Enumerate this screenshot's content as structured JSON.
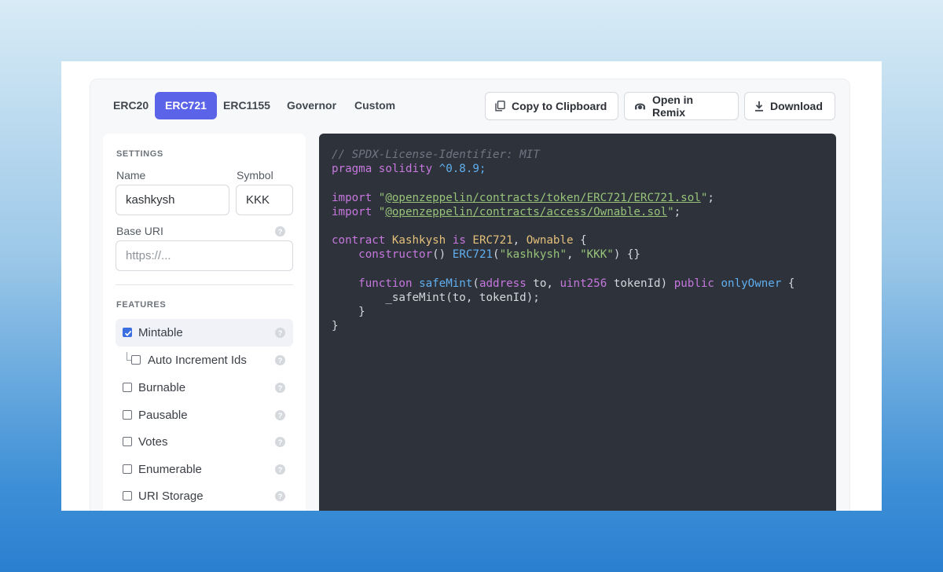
{
  "tabs": [
    {
      "label": "ERC20",
      "active": false
    },
    {
      "label": "ERC721",
      "active": true
    },
    {
      "label": "ERC1155",
      "active": false
    },
    {
      "label": "Governor",
      "active": false
    },
    {
      "label": "Custom",
      "active": false
    }
  ],
  "actions": {
    "copy_label": "Copy to Clipboard",
    "remix_label": "Open in Remix",
    "download_label": "Download"
  },
  "settings": {
    "section_title": "SETTINGS",
    "name_label": "Name",
    "name_value": "kashkysh",
    "symbol_label": "Symbol",
    "symbol_value": "KKK",
    "base_uri_label": "Base URI",
    "base_uri_placeholder": "https://...",
    "base_uri_value": ""
  },
  "features": {
    "section_title": "FEATURES",
    "items": [
      {
        "label": "Mintable",
        "checked": true
      },
      {
        "label": "Auto Increment Ids",
        "checked": false
      },
      {
        "label": "Burnable",
        "checked": false
      },
      {
        "label": "Pausable",
        "checked": false
      },
      {
        "label": "Votes",
        "checked": false
      },
      {
        "label": "Enumerable",
        "checked": false
      },
      {
        "label": "URI Storage",
        "checked": false
      }
    ]
  },
  "colors": {
    "accent": "#5b63e8",
    "checkbox": "#3b6fe0",
    "code_background": "#2d323b"
  },
  "icons": {
    "copy": "copy-icon",
    "remix": "remix-icon",
    "download": "download-icon",
    "help": "help-icon",
    "check": "check-icon"
  },
  "code": {
    "comment": "// SPDX-License-Identifier: MIT",
    "pragma_kw": "pragma solidity",
    "pragma_version": "^0.8.9;",
    "import_kw": "import",
    "import1_path": "@openzeppelin/contracts/token/ERC721/ERC721.sol",
    "import2_path": "@openzeppelin/contracts/access/Ownable.sol",
    "quote": "\"",
    "semicolon": ";",
    "contract_kw": "contract",
    "contract_name": "Kashkysh",
    "is_kw": "is",
    "base1": "ERC721",
    "comma": ",",
    "base2": "Ownable",
    "open_brace": "{",
    "constructor_kw": "constructor",
    "constructor_parens": "()",
    "ctor_call": "ERC721",
    "ctor_arg1": "\"kashkysh\"",
    "ctor_arg2": "\"KKK\"",
    "ctor_tail": ") {}",
    "function_kw": "function",
    "function_name": "safeMint",
    "address_kw": "address",
    "param_to": "to,",
    "uint_kw": "uint256",
    "param_token": "tokenId)",
    "public_kw": "public",
    "modifier": "onlyOwner",
    "body_line": "_safeMint(to, tokenId);",
    "close_brace": "}"
  }
}
